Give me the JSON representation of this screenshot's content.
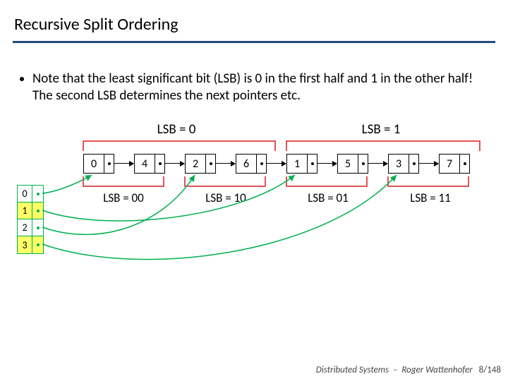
{
  "title": "Recursive Split Ordering",
  "bullet": "Note that the least significant bit (LSB) is 0 in the first half and 1 in the other half! The second LSB determines the next pointers etc.",
  "lsb_top": {
    "left": "LSB = 0",
    "right": "LSB = 1"
  },
  "chain": [
    "0",
    "4",
    "2",
    "6",
    "1",
    "5",
    "3",
    "7"
  ],
  "lsb_bottom": [
    "LSB = 00",
    "LSB = 10",
    "LSB = 01",
    "LSB = 11"
  ],
  "vtable": [
    "0",
    "1",
    "2",
    "3"
  ],
  "footer": {
    "course": "Distributed Systems",
    "sep": "–",
    "author": "Roger Wattenhofer",
    "page": "8/148"
  }
}
